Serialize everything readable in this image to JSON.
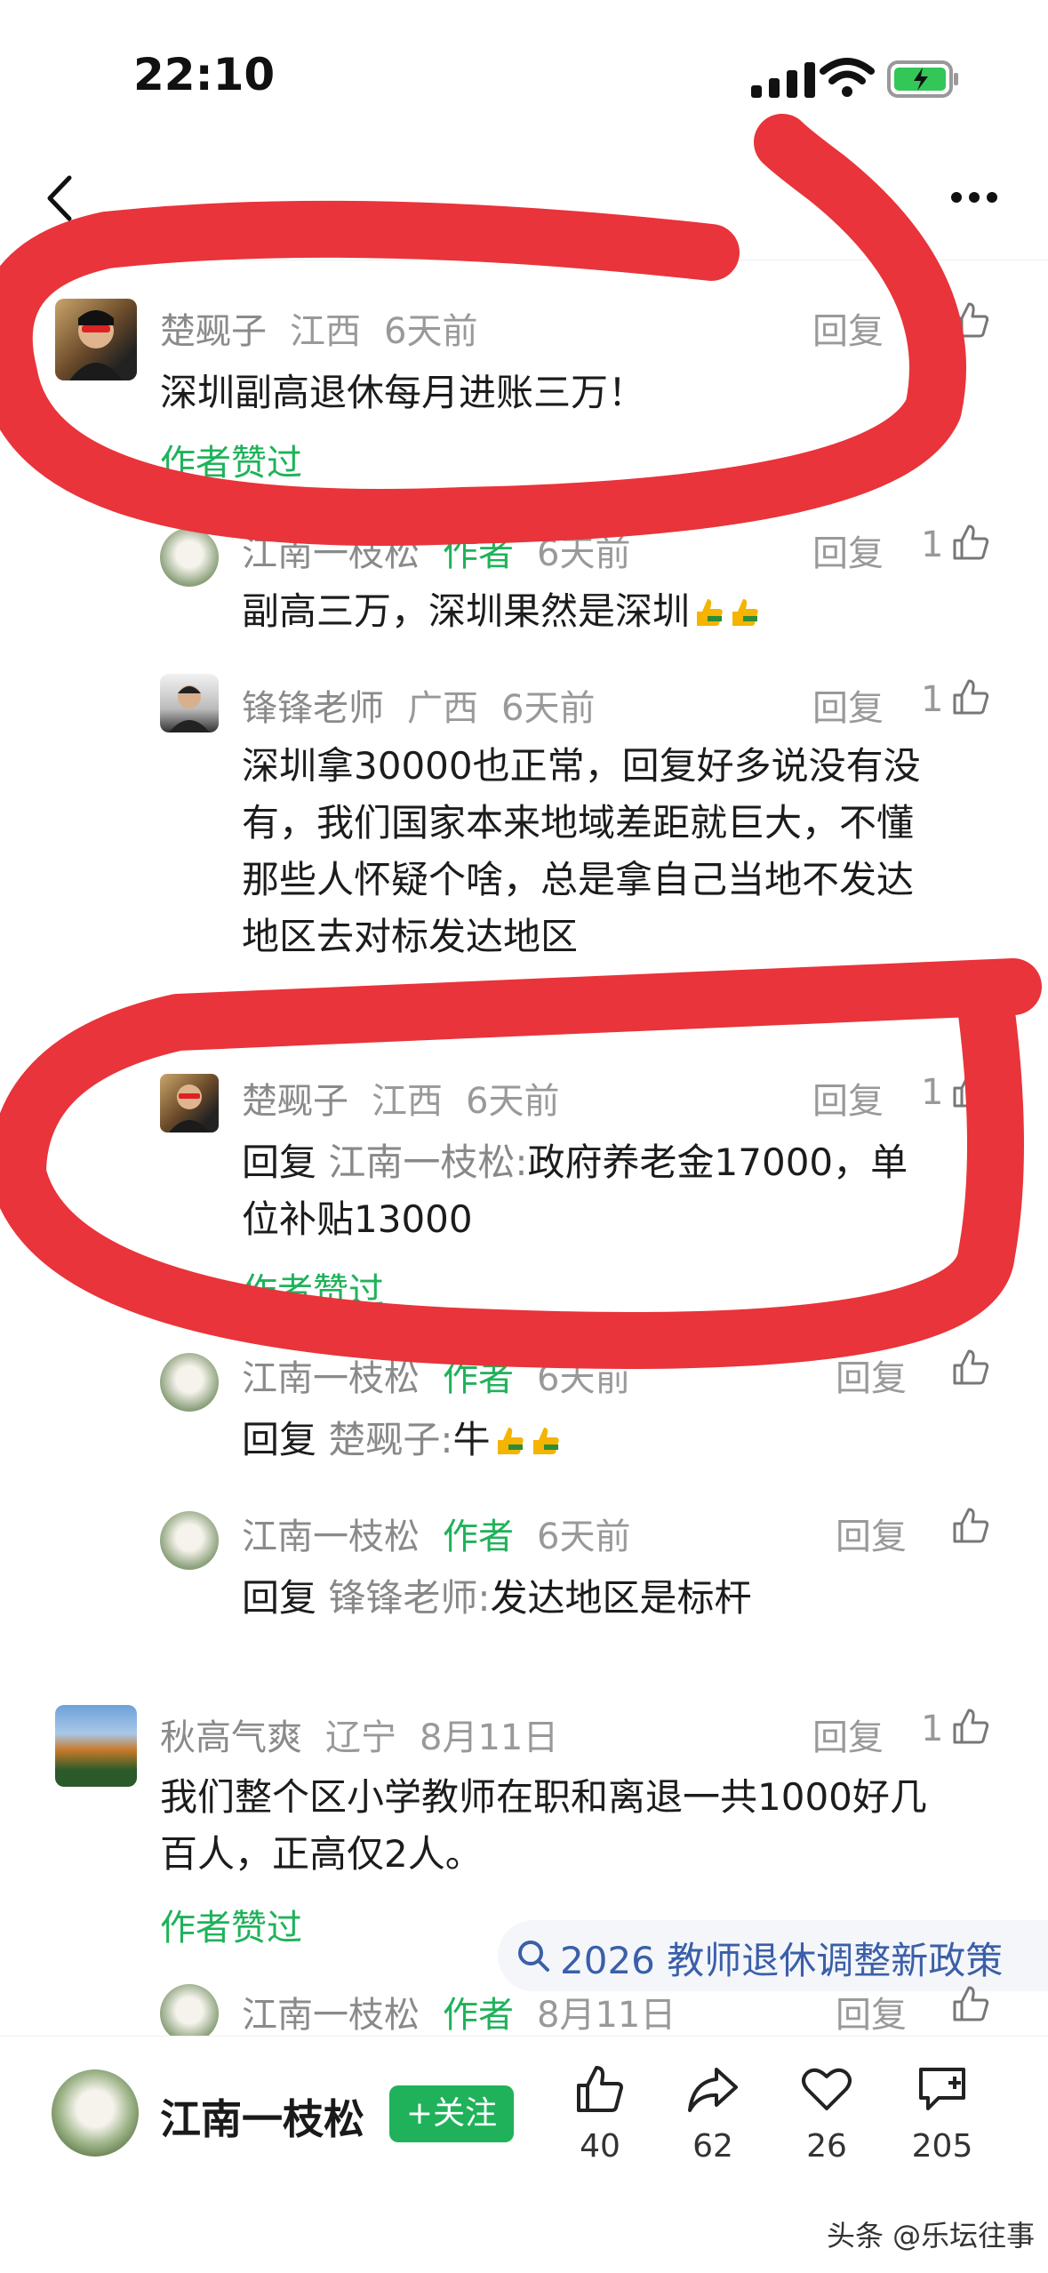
{
  "status_bar": {
    "time": "22:10"
  },
  "comments": [
    {
      "name": "楚觋子",
      "location": "江西",
      "time": "6天前",
      "reply": "回复",
      "likes": "1",
      "text": "深圳副高退休每月进账三万！",
      "liked_by_author": "作者赞过"
    },
    {
      "name": "江南一枝松",
      "author_tag": "作者",
      "time": "6天前",
      "reply": "回复",
      "likes": "1",
      "text": "副高三万，深圳果然是深圳"
    },
    {
      "name": "锋锋老师",
      "location": "广西",
      "time": "6天前",
      "reply": "回复",
      "likes": "1",
      "text_lines": [
        "深圳拿30000也正常，回复好多说没有没",
        "有，我们国家本来地域差距就巨大，不懂",
        "那些人怀疑个啥，总是拿自己当地不发达",
        "地区去对标发达地区"
      ]
    },
    {
      "name": "楚觋子",
      "location": "江西",
      "time": "6天前",
      "reply": "回复",
      "likes": "1",
      "reply_prefix": "回复",
      "reply_to": "江南一枝松:",
      "text_lines": [
        "政府养老金17000，单",
        "位补贴13000"
      ],
      "liked_by_author": "作者赞过"
    },
    {
      "name": "江南一枝松",
      "author_tag": "作者",
      "time": "6天前",
      "reply": "回复",
      "reply_prefix": "回复",
      "reply_to": "楚觋子:",
      "text": "牛"
    },
    {
      "name": "江南一枝松",
      "author_tag": "作者",
      "time": "6天前",
      "reply": "回复",
      "reply_prefix": "回复",
      "reply_to": "锋锋老师:",
      "text": "发达地区是标杆"
    },
    {
      "name": "秋高气爽",
      "location": "辽宁",
      "time": "8月11日",
      "reply": "回复",
      "likes": "1",
      "text_lines": [
        "我们整个区小学教师在职和离退一共1000好几",
        "百人，正高仅2人。"
      ],
      "liked_by_author": "作者赞过"
    },
    {
      "name": "江南一枝松",
      "author_tag": "作者",
      "time": "8月11日",
      "reply": "回复"
    }
  ],
  "suggest": {
    "text": "2026 教师退休调整新政策"
  },
  "bottom": {
    "author_name": "江南一枝松",
    "follow": "+关注",
    "likes": "40",
    "shares": "62",
    "favorites": "26",
    "comments": "205"
  },
  "watermark": "头条 @乐坛往事",
  "colors": {
    "accent": "#1fb25a",
    "annotation": "#e8343a"
  }
}
